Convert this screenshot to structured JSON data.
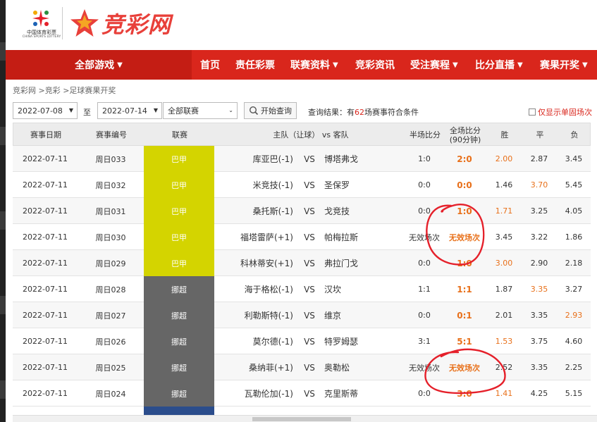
{
  "header": {
    "lottery_cn": "中国体育彩票",
    "lottery_en": "CHINA SPORTS LOTTERY",
    "brand_name": "竞彩网"
  },
  "nav": {
    "all_games": "全部游戏",
    "items": [
      {
        "label": "首页",
        "dropdown": false
      },
      {
        "label": "责任彩票",
        "dropdown": false
      },
      {
        "label": "联赛资料",
        "dropdown": true
      },
      {
        "label": "竞彩资讯",
        "dropdown": false
      },
      {
        "label": "受注赛程",
        "dropdown": true
      },
      {
        "label": "比分直播",
        "dropdown": true
      },
      {
        "label": "赛果开奖",
        "dropdown": true
      }
    ]
  },
  "breadcrumb": "竞彩网 >竞彩 >足球赛果开奖",
  "filter": {
    "start_date": "2022-07-08",
    "to_label": "至",
    "end_date": "2022-07-14",
    "league": "全部联赛",
    "query_button": "开始查询",
    "result_prefix": "查询结果：有",
    "result_count": "62",
    "result_suffix": "场赛事符合条件",
    "only_single": "仅显示单固场次"
  },
  "table": {
    "headers": {
      "date": "赛事日期",
      "code": "赛事编号",
      "league": "联赛",
      "teams": "主队（让球） vs 客队",
      "half": "半场比分",
      "full_line1": "全场比分",
      "full_line2": "(90分钟)",
      "win": "胜",
      "draw": "平",
      "lose": "负"
    },
    "vs": "VS",
    "rows": [
      {
        "date": "2022-07-11",
        "code": "周日033",
        "league": "巴甲",
        "home": "库亚巴(-1)",
        "away": "博塔弗戈",
        "half": "1:0",
        "full": "2:0",
        "win": "2.00",
        "draw": "2.87",
        "lose": "3.45",
        "result": "win"
      },
      {
        "date": "2022-07-11",
        "code": "周日032",
        "league": "巴甲",
        "home": "米竞技(-1)",
        "away": "圣保罗",
        "half": "0:0",
        "full": "0:0",
        "win": "1.46",
        "draw": "3.70",
        "lose": "5.45",
        "result": "draw"
      },
      {
        "date": "2022-07-11",
        "code": "周日031",
        "league": "巴甲",
        "home": "桑托斯(-1)",
        "away": "戈竞技",
        "half": "0:0",
        "full": "1:0",
        "win": "1.71",
        "draw": "3.25",
        "lose": "4.05",
        "result": "win"
      },
      {
        "date": "2022-07-11",
        "code": "周日030",
        "league": "巴甲",
        "home": "福塔雷萨(+1)",
        "away": "帕梅拉斯",
        "half": "无效场次",
        "full": "无效场次",
        "win": "3.45",
        "draw": "3.22",
        "lose": "1.86",
        "result": "none"
      },
      {
        "date": "2022-07-11",
        "code": "周日029",
        "league": "巴甲",
        "home": "科林蒂安(+1)",
        "away": "弗拉门戈",
        "half": "0:0",
        "full": "1:0",
        "win": "3.00",
        "draw": "2.90",
        "lose": "2.18",
        "result": "win"
      },
      {
        "date": "2022-07-11",
        "code": "周日028",
        "league": "挪超",
        "home": "海于格松(-1)",
        "away": "汉坎",
        "half": "1:1",
        "full": "1:1",
        "win": "1.87",
        "draw": "3.35",
        "lose": "3.27",
        "result": "draw"
      },
      {
        "date": "2022-07-11",
        "code": "周日027",
        "league": "挪超",
        "home": "利勒斯特(-1)",
        "away": "维京",
        "half": "0:0",
        "full": "0:1",
        "win": "2.01",
        "draw": "3.35",
        "lose": "2.93",
        "result": "lose"
      },
      {
        "date": "2022-07-11",
        "code": "周日026",
        "league": "挪超",
        "home": "莫尔德(-1)",
        "away": "特罗姆瑟",
        "half": "3:1",
        "full": "5:1",
        "win": "1.53",
        "draw": "3.75",
        "lose": "4.60",
        "result": "win"
      },
      {
        "date": "2022-07-11",
        "code": "周日025",
        "league": "挪超",
        "home": "桑纳菲(+1)",
        "away": "奥勒松",
        "half": "无效场次",
        "full": "无效场次",
        "win": "2.52",
        "draw": "3.35",
        "lose": "2.25",
        "result": "none"
      },
      {
        "date": "2022-07-11",
        "code": "周日024",
        "league": "挪超",
        "home": "瓦勒伦加(-1)",
        "away": "克里斯蒂",
        "half": "0:0",
        "full": "3:0",
        "win": "1.41",
        "draw": "4.25",
        "lose": "5.15",
        "result": "win"
      }
    ]
  },
  "colors": {
    "nav_red": "#d9261c",
    "league_brazil": "#d4d400",
    "league_norway": "#666666",
    "highlight_orange": "#e8701a",
    "annotation_red": "#e5202a"
  }
}
